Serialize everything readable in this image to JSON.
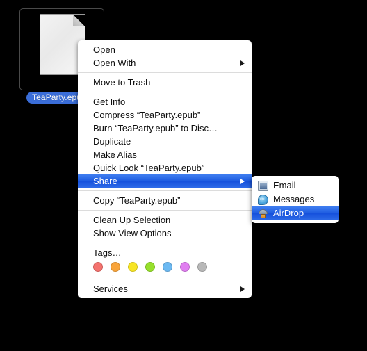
{
  "desktop": {
    "background_color": "#000000"
  },
  "file": {
    "name": "TeaParty.epub",
    "icon": "blank-document-icon",
    "selected": true,
    "label_background": "#3a6dd8"
  },
  "context_menu": {
    "highlight_color": "#1d5be0",
    "groups": [
      {
        "items": [
          {
            "label": "Open",
            "has_submenu": false,
            "highlighted": false
          },
          {
            "label": "Open With",
            "has_submenu": true,
            "highlighted": false
          }
        ]
      },
      {
        "items": [
          {
            "label": "Move to Trash",
            "has_submenu": false,
            "highlighted": false
          }
        ]
      },
      {
        "items": [
          {
            "label": "Get Info",
            "has_submenu": false,
            "highlighted": false
          },
          {
            "label": "Compress “TeaParty.epub”",
            "has_submenu": false,
            "highlighted": false
          },
          {
            "label": "Burn “TeaParty.epub” to Disc…",
            "has_submenu": false,
            "highlighted": false
          },
          {
            "label": "Duplicate",
            "has_submenu": false,
            "highlighted": false
          },
          {
            "label": "Make Alias",
            "has_submenu": false,
            "highlighted": false
          },
          {
            "label": "Quick Look “TeaParty.epub”",
            "has_submenu": false,
            "highlighted": false
          },
          {
            "label": "Share",
            "has_submenu": true,
            "highlighted": true
          }
        ]
      },
      {
        "items": [
          {
            "label": "Copy “TeaParty.epub”",
            "has_submenu": false,
            "highlighted": false
          }
        ]
      },
      {
        "items": [
          {
            "label": "Clean Up Selection",
            "has_submenu": false,
            "highlighted": false
          },
          {
            "label": "Show View Options",
            "has_submenu": false,
            "highlighted": false
          }
        ]
      },
      {
        "items": [
          {
            "label": "Tags…",
            "has_submenu": false,
            "highlighted": false
          }
        ]
      },
      {
        "items": [
          {
            "label": "Services",
            "has_submenu": true,
            "highlighted": false
          }
        ]
      }
    ],
    "tags": [
      {
        "name": "red-tag",
        "color": "#f4726e"
      },
      {
        "name": "orange-tag",
        "color": "#f9a43a"
      },
      {
        "name": "yellow-tag",
        "color": "#f7e525"
      },
      {
        "name": "green-tag",
        "color": "#97e02c"
      },
      {
        "name": "blue-tag",
        "color": "#6cb9f2"
      },
      {
        "name": "purple-tag",
        "color": "#e07ef0"
      },
      {
        "name": "gray-tag",
        "color": "#b8b8b8"
      }
    ]
  },
  "share_submenu": {
    "items": [
      {
        "label": "Email",
        "icon": "mail-icon",
        "highlighted": false
      },
      {
        "label": "Messages",
        "icon": "messages-icon",
        "highlighted": false
      },
      {
        "label": "AirDrop",
        "icon": "airdrop-icon",
        "highlighted": true
      }
    ]
  }
}
